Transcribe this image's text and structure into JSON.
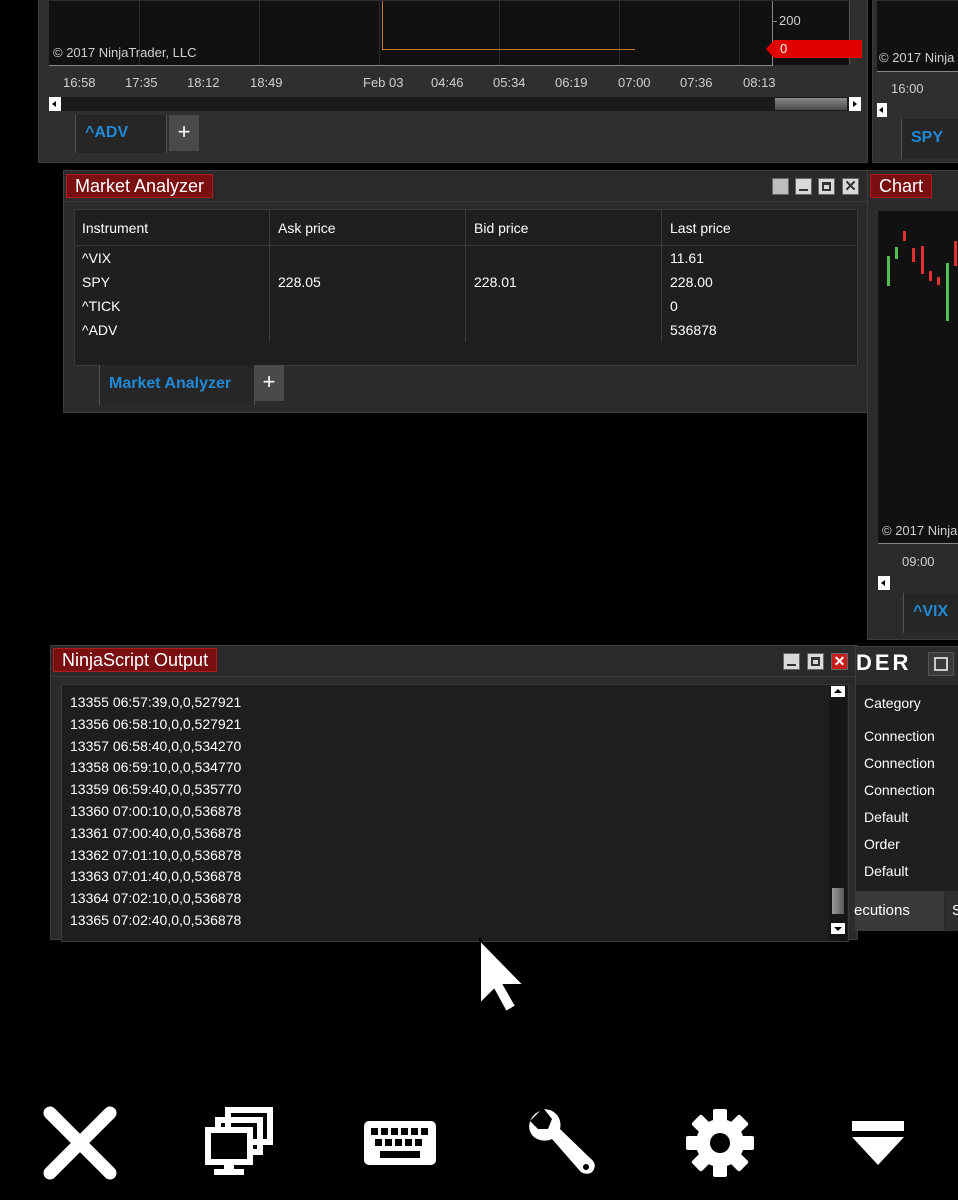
{
  "chart_top": {
    "copyright": "© 2017 NinjaTrader, LLC",
    "price_label": "200",
    "price_marker": "0",
    "time_ticks": [
      "16:58",
      "17:35",
      "18:12",
      "18:49",
      "Feb 03",
      "04:46",
      "05:34",
      "06:19",
      "07:00",
      "07:36",
      "08:13"
    ],
    "tab_label": "^ADV",
    "plus": "+"
  },
  "chart_right_top": {
    "copyright": "© 2017 Ninja",
    "time_tick": "16:00",
    "tab_label": "SPY"
  },
  "market_analyzer": {
    "title": "Market Analyzer",
    "columns": [
      "Instrument",
      "Ask price",
      "Bid price",
      "Last price"
    ],
    "rows": [
      {
        "instrument": "^VIX",
        "ask": "",
        "bid": "",
        "last": "11.61"
      },
      {
        "instrument": "SPY",
        "ask": "228.05",
        "bid": "228.01",
        "last": "228.00"
      },
      {
        "instrument": "^TICK",
        "ask": "",
        "bid": "",
        "last": "0"
      },
      {
        "instrument": "^ADV",
        "ask": "",
        "bid": "",
        "last": "536878"
      }
    ],
    "tab_label": "Market Analyzer",
    "plus": "+"
  },
  "chart_right": {
    "title": "Chart",
    "copyright": "© 2017 Ninja",
    "time_tick": "09:00",
    "tab_label": "^VIX"
  },
  "ninjascript_output": {
    "title": "NinjaScript Output",
    "lines": [
      "13355 06:57:39,0,0,527921",
      "13356 06:58:10,0,0,527921",
      "13357 06:58:40,0,0,534270",
      "13358 06:59:10,0,0,534770",
      "13359 06:59:40,0,0,535770",
      "13360 07:00:10,0,0,536878",
      "13361 07:00:40,0,0,536878",
      "13362 07:01:10,0,0,536878",
      "13363 07:01:40,0,0,536878",
      "13364 07:02:10,0,0,536878",
      "13365 07:02:40,0,0,536878"
    ]
  },
  "control_center": {
    "title_partial": "DER",
    "category_header": "Category",
    "categories": [
      "Connection",
      "Connection",
      "Connection",
      "Default",
      "Order",
      "Default"
    ],
    "tab_partial": "ecutions",
    "tab_partial2": "S"
  },
  "toolbar": {
    "icons": [
      "close-icon",
      "windows-icon",
      "keyboard-icon",
      "wrench-icon",
      "gear-icon",
      "dropdown-icon"
    ]
  },
  "colors": {
    "title_red": "#7a0f12",
    "tab_blue": "#1f8ad6",
    "panel_bg": "#2b2b2b",
    "marker_red": "#e00000"
  }
}
